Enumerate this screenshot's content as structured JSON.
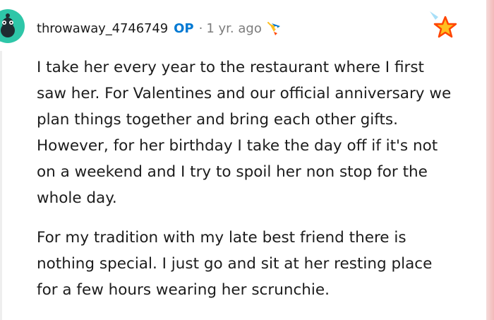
{
  "comment": {
    "author": "throwaway_4746749",
    "op_badge": "OP",
    "separator": "·",
    "timestamp": "1 yr. ago",
    "paragraphs": [
      "I take her every year to the restaurant where I first saw her. For Valentines and our official anniversary we plan things together and bring each other gifts. However, for her birthday I take the day off if it's not on a weekend and I try to spoil her non stop for the whole day.",
      "For my tradition with my late best friend there is nothing special. I just go and sit at her resting place for a few hours wearing her scrunchie."
    ]
  },
  "icons": {
    "avatar": "snoo-avatar-icon",
    "inline_award": "rocket-award-icon",
    "corner_award": "star-award-icon"
  },
  "colors": {
    "avatar_teal": "#2ec6a8",
    "op_blue": "#0079d3",
    "meta_gray": "#7c7c7c",
    "star_gold": "#ffbf1f"
  }
}
